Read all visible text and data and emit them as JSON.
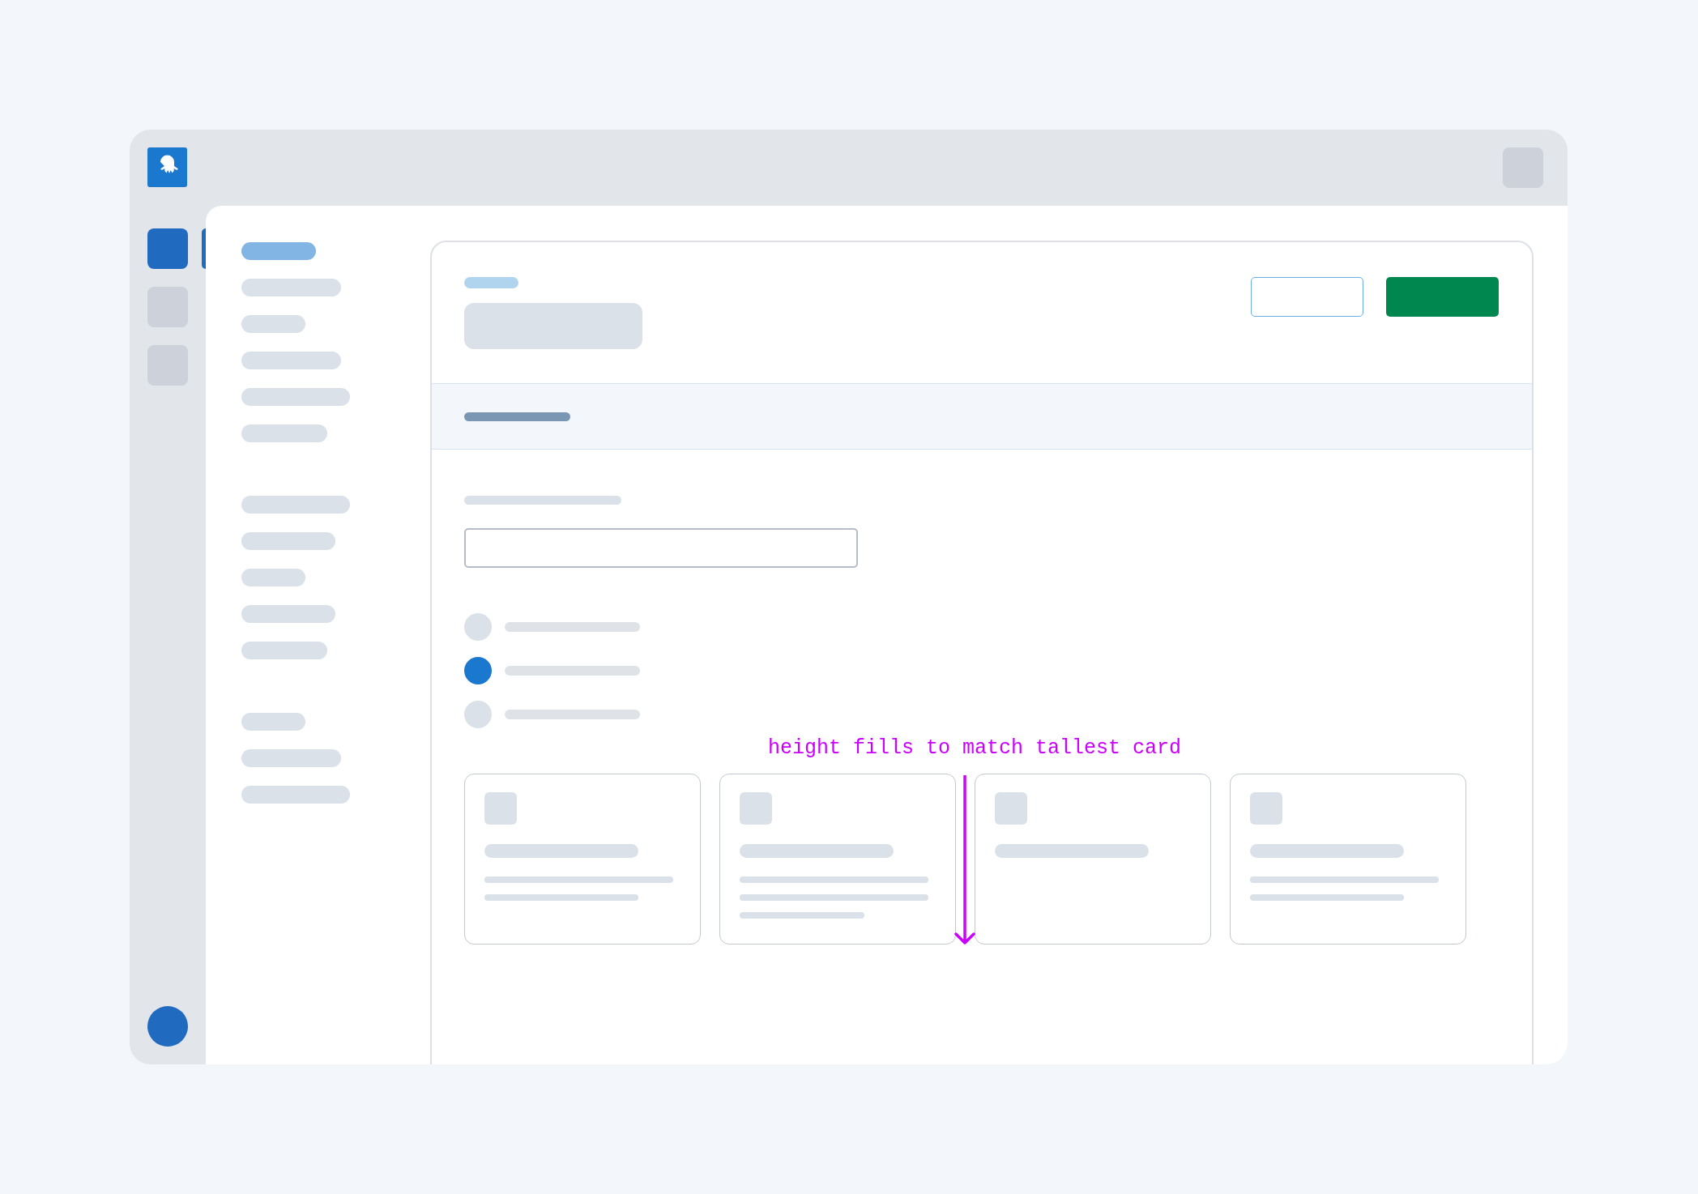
{
  "nav_rail": {
    "items": [
      {
        "selected": true
      },
      {
        "selected": false
      },
      {
        "selected": false
      }
    ]
  },
  "sidebar": {
    "groups": [
      {
        "items": [
          {
            "selected": true
          },
          {
            "selected": false
          },
          {
            "selected": false
          },
          {
            "selected": false
          },
          {
            "selected": false
          },
          {
            "selected": false
          }
        ]
      },
      {
        "items": [
          {
            "selected": false
          },
          {
            "selected": false
          },
          {
            "selected": false
          },
          {
            "selected": false
          },
          {
            "selected": false
          }
        ]
      },
      {
        "items": [
          {
            "selected": false
          },
          {
            "selected": false
          },
          {
            "selected": false
          }
        ]
      }
    ]
  },
  "page": {
    "header_buttons": [
      {
        "kind": "secondary"
      },
      {
        "kind": "primary"
      }
    ],
    "radio_options": [
      {
        "selected": false
      },
      {
        "selected": true
      },
      {
        "selected": false
      }
    ],
    "annotation": {
      "text": "height fills to match tallest card"
    },
    "cards": [
      {
        "kind": "detailed",
        "lines": [
          {
            "kind": "full"
          },
          {
            "kind": "partial"
          }
        ]
      },
      {
        "kind": "detailed",
        "lines": [
          {
            "kind": "full"
          },
          {
            "kind": "full"
          },
          {
            "kind": "short"
          }
        ]
      },
      {
        "kind": "title_only"
      },
      {
        "kind": "detailed",
        "lines": [
          {
            "kind": "full"
          },
          {
            "kind": "partial"
          }
        ]
      }
    ]
  }
}
